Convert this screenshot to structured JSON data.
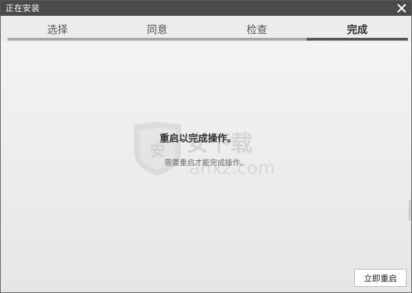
{
  "window": {
    "title": "正在安装"
  },
  "steps": [
    {
      "label": "选择",
      "active": false
    },
    {
      "label": "同意",
      "active": false
    },
    {
      "label": "检查",
      "active": false
    },
    {
      "label": "完成",
      "active": true
    }
  ],
  "message": {
    "title": "重启以完成操作。",
    "subtitle": "需要重启才能完成操作。"
  },
  "footer": {
    "restart_label": "立即重启"
  },
  "watermark": {
    "badge_char": "安",
    "brand_cn": "安下载",
    "brand_en": "anxz.com"
  },
  "icons": {
    "close": "close-icon",
    "watermark_shield": "shield-icon"
  },
  "colors": {
    "titlebar": "#4a4a4a",
    "active_step": "#555555",
    "inactive_step": "#a7a7a7",
    "background": "#ececec"
  }
}
